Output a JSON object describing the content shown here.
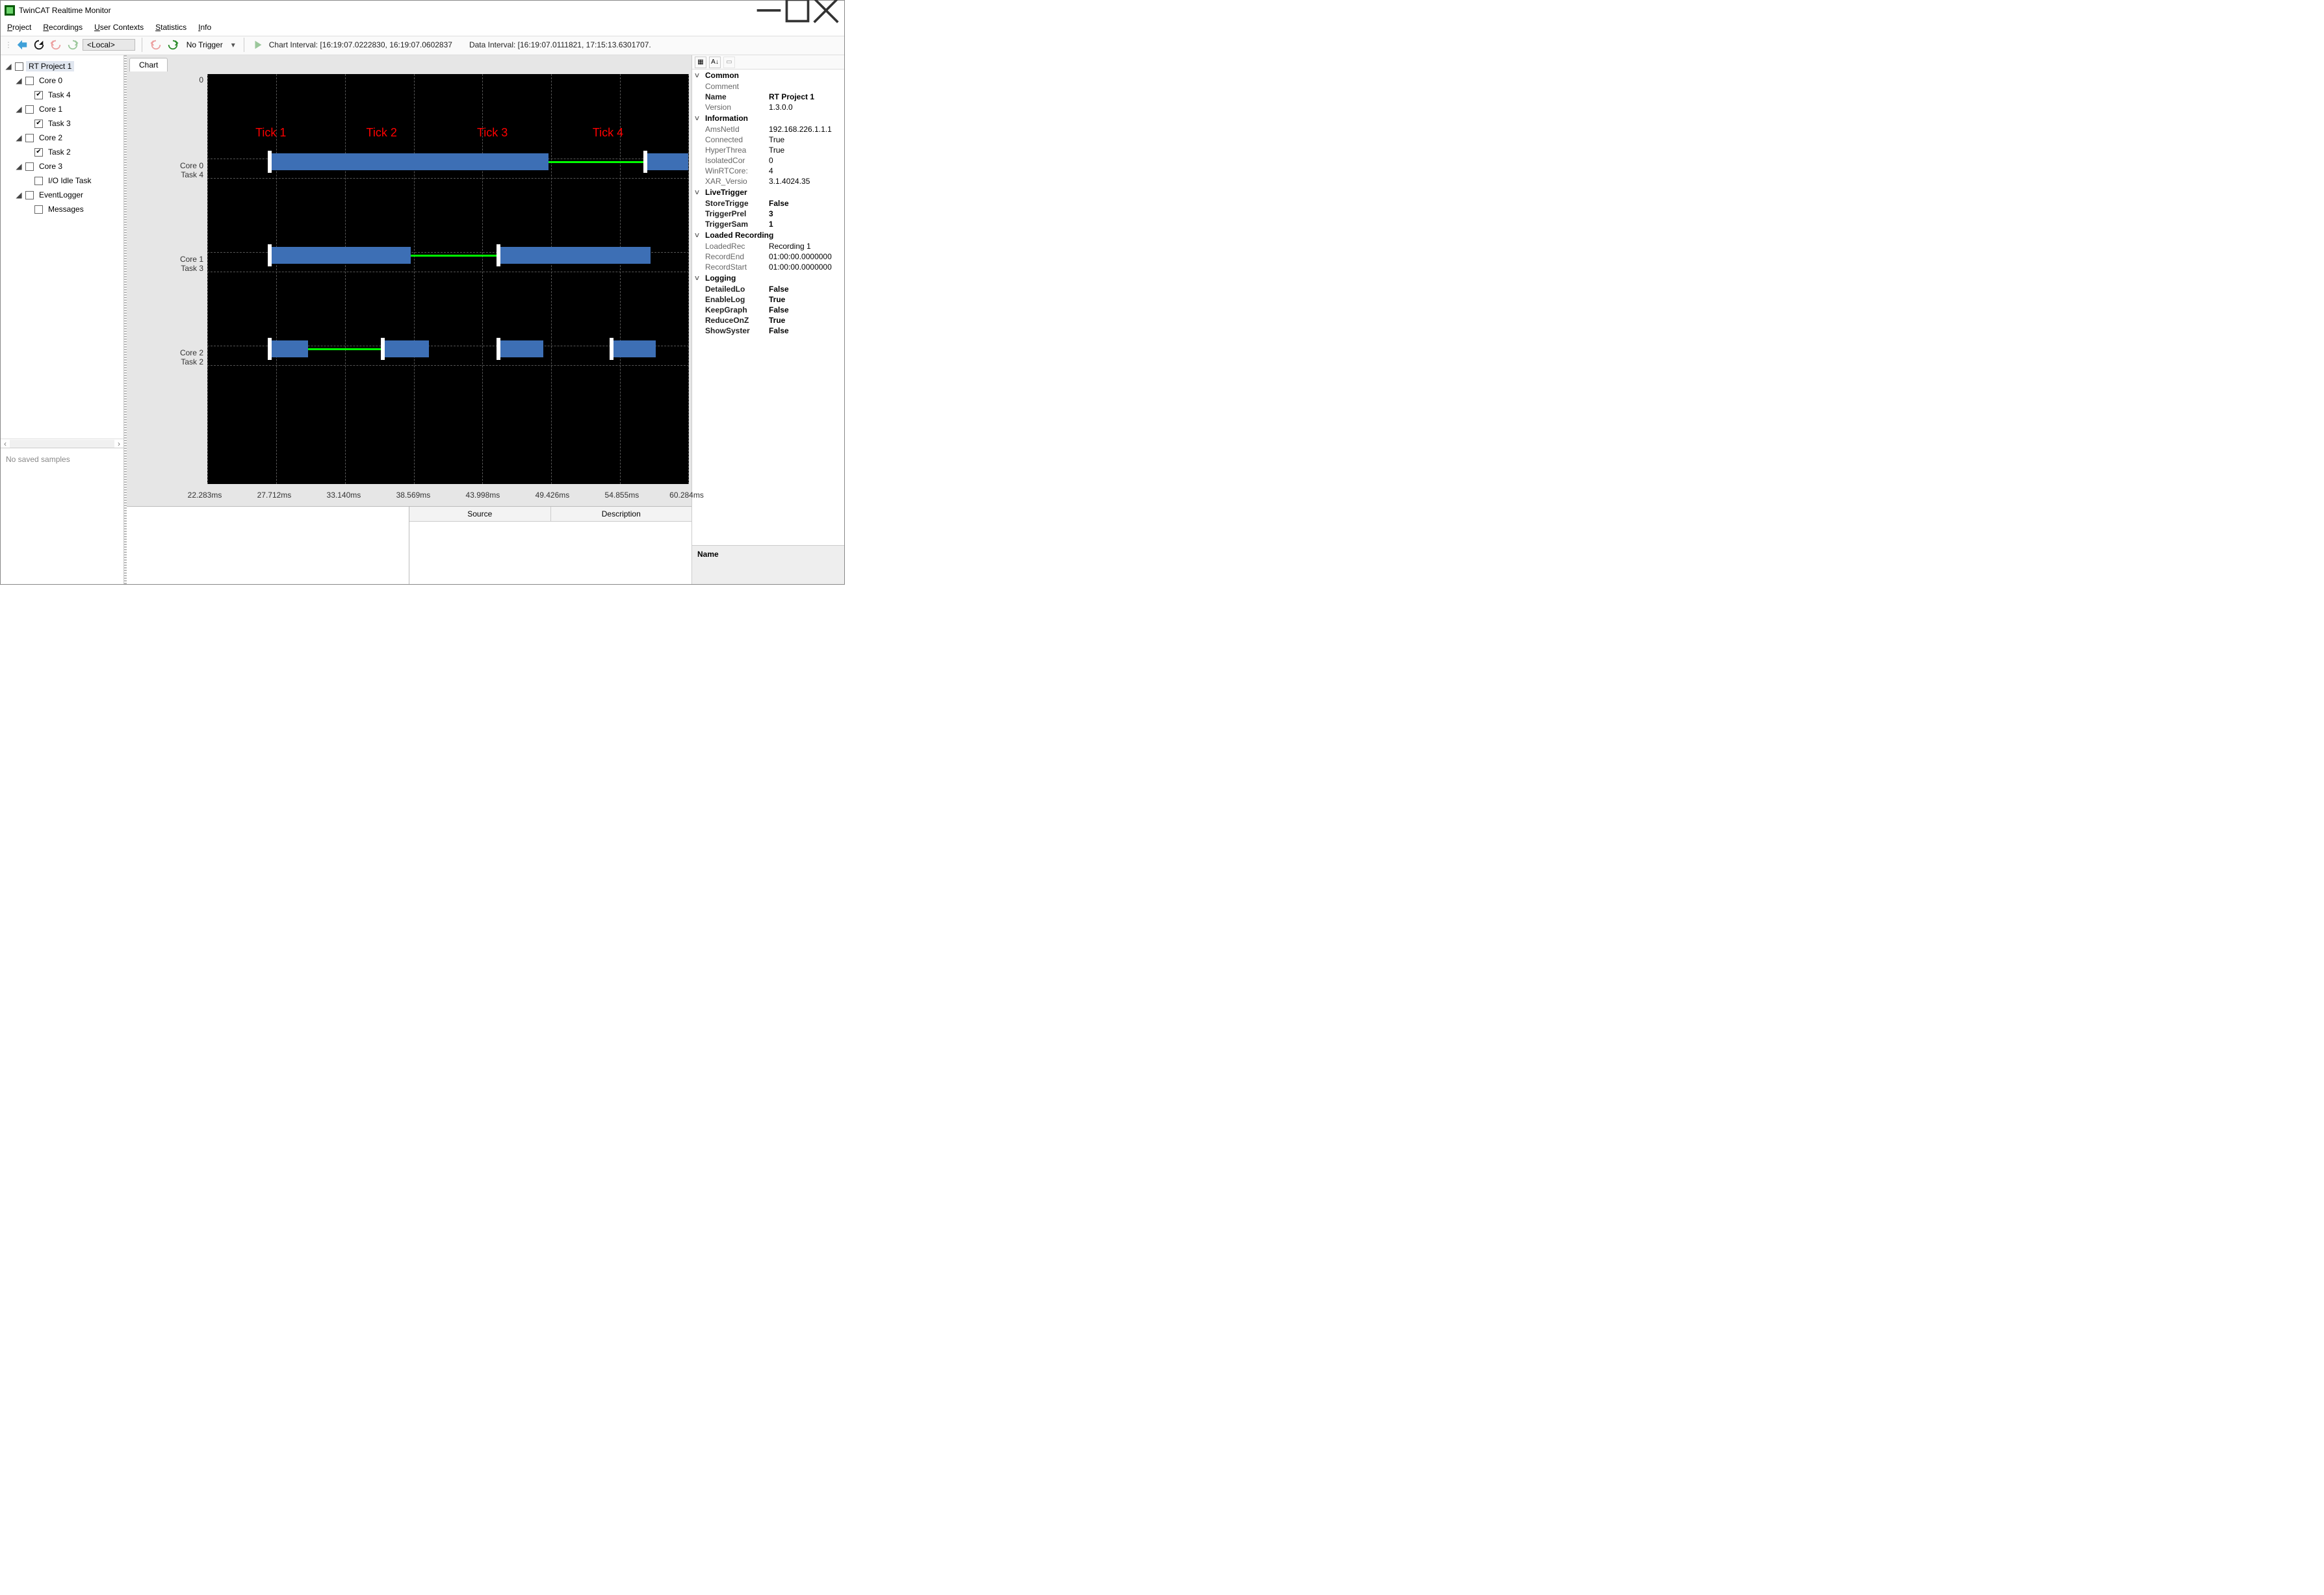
{
  "titlebar": {
    "title": "TwinCAT Realtime Monitor"
  },
  "menu": {
    "project": "Project",
    "recordings": "Recordings",
    "userContexts": "User Contexts",
    "statistics": "Statistics",
    "info": "Info"
  },
  "toolbar": {
    "target": "<Local>",
    "trigger": "No Trigger",
    "chartInterval": "Chart Interval: [16:19:07.0222830, 16:19:07.0602837",
    "dataInterval": "Data Interval: [16:19:07.0111821, 17:15:13.6301707."
  },
  "tree": {
    "project": "RT Project 1",
    "core0": "Core 0",
    "task4": "Task 4",
    "core1": "Core 1",
    "task3": "Task 3",
    "core2": "Core 2",
    "task2": "Task 2",
    "core3": "Core 3",
    "ioidle": "I/O Idle Task",
    "eventlogger": "EventLogger",
    "messages": "Messages"
  },
  "savedSamples": "No saved samples",
  "tabs": {
    "chart": "Chart"
  },
  "yTop": "0",
  "rowLabels": {
    "c0a": "Core 0",
    "c0b": "Task 4",
    "c1a": "Core 1",
    "c1b": "Task 3",
    "c2a": "Core 2",
    "c2b": "Task 2"
  },
  "tickLabels": {
    "t1": "Tick 1",
    "t2": "Tick 2",
    "t3": "Tick 3",
    "t4": "Tick 4"
  },
  "chart_data": {
    "type": "bar",
    "xlabel": "",
    "ylabel": "",
    "x_range_ms": [
      22.283,
      60.284
    ],
    "x_ticks_ms": [
      22.283,
      27.712,
      33.14,
      38.569,
      43.998,
      49.426,
      54.855,
      60.284
    ],
    "annotations": [
      "Tick 1",
      "Tick 2",
      "Tick 3",
      "Tick 4"
    ],
    "annotation_x_ms": [
      27.2,
      36.0,
      45.0,
      55.5
    ],
    "series": [
      {
        "name": "Core 0 / Task 4",
        "bars_ms": [
          [
            27.2,
            49.2
          ],
          [
            57.0,
            60.284
          ]
        ],
        "idle_ms": [
          [
            49.2,
            56.7
          ]
        ],
        "tick_marks_ms": [
          27.0,
          56.7
        ]
      },
      {
        "name": "Core 1 / Task 3",
        "bars_ms": [
          [
            27.2,
            38.4
          ],
          [
            45.2,
            57.2
          ]
        ],
        "idle_ms": [
          [
            38.4,
            45.2
          ]
        ],
        "tick_marks_ms": [
          27.0,
          45.0
        ]
      },
      {
        "name": "Core 2 / Task 2",
        "bars_ms": [
          [
            27.2,
            30.2
          ],
          [
            36.2,
            39.6
          ],
          [
            45.2,
            48.6
          ],
          [
            54.2,
            57.6
          ]
        ],
        "idle_ms": [
          [
            30.2,
            36.0
          ]
        ],
        "tick_marks_ms": [
          27.0,
          36.0,
          45.0,
          54.0
        ]
      }
    ]
  },
  "xAxis": {
    "t0": "22.283ms",
    "t1": "27.712ms",
    "t2": "33.140ms",
    "t3": "38.569ms",
    "t4": "43.998ms",
    "t5": "49.426ms",
    "t6": "54.855ms",
    "t7": "60.284ms"
  },
  "bottom": {
    "source": "Source",
    "description": "Description"
  },
  "props": {
    "cat_common": "Common",
    "comment_k": "Comment",
    "comment_v": "",
    "name_k": "Name",
    "name_v": "RT Project 1",
    "version_k": "Version",
    "version_v": "1.3.0.0",
    "cat_info": "Information",
    "ams_k": "AmsNetId",
    "ams_v": "192.168.226.1.1.1",
    "conn_k": "Connected",
    "conn_v": "True",
    "hyper_k": "HyperThrea",
    "hyper_v": "True",
    "iso_k": "IsolatedCor",
    "iso_v": "0",
    "winrt_k": "WinRTCore:",
    "winrt_v": "4",
    "xar_k": "XAR_Versio",
    "xar_v": "3.1.4024.35",
    "cat_live": "LiveTrigger",
    "store_k": "StoreTrigge",
    "store_v": "False",
    "trigp_k": "TriggerPrel",
    "trigp_v": "3",
    "trigs_k": "TriggerSam",
    "trigs_v": "1",
    "cat_loaded": "Loaded Recording",
    "lrec_k": "LoadedRec",
    "lrec_v": "Recording 1",
    "rend_k": "RecordEnd",
    "rend_v": "01:00:00.0000000",
    "rstart_k": "RecordStart",
    "rstart_v": "01:00:00.0000000",
    "cat_log": "Logging",
    "dlog_k": "DetailedLo",
    "dlog_v": "False",
    "elog_k": "EnableLog",
    "elog_v": "True",
    "kgraph_k": "KeepGraph",
    "kgraph_v": "False",
    "ronz_k": "ReduceOnZ",
    "ronz_v": "True",
    "ssys_k": "ShowSyster",
    "ssys_v": "False"
  },
  "nameBox": {
    "label": "Name"
  }
}
